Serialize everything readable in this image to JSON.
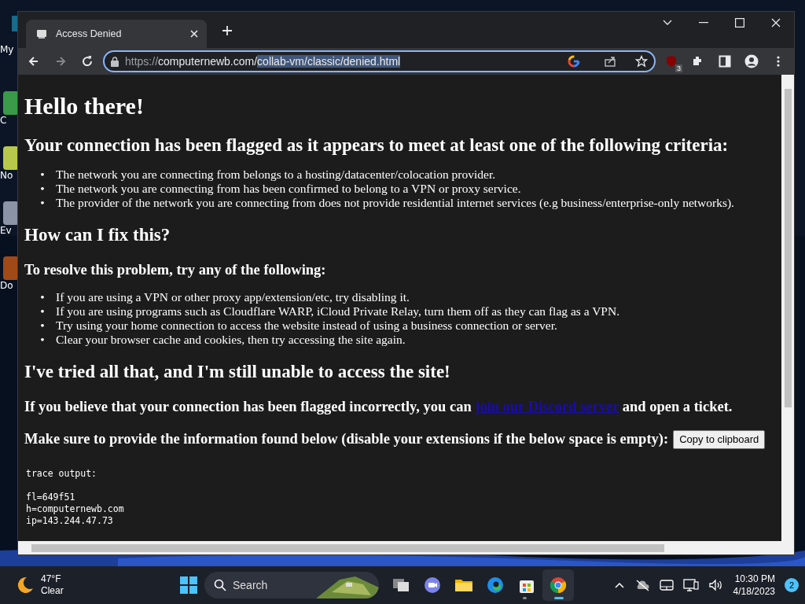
{
  "desktop_icons": [
    {
      "label": "My"
    },
    {
      "label": "C"
    },
    {
      "label": "No"
    },
    {
      "label": "Ev"
    },
    {
      "label": "Do"
    }
  ],
  "browser": {
    "tabs": [
      {
        "title": "Access Denied",
        "selected": true
      }
    ],
    "address": {
      "scheme": "https://",
      "host": "computernewb.com/",
      "selected_path": "collab-vm/classic/denied.html"
    },
    "extension_badge": "3",
    "page": [
      {
        "kind": "h1",
        "text": "Hello there!"
      },
      {
        "kind": "h2",
        "text": "Your connection has been flagged as it appears to meet at least one of the following criteria:"
      },
      {
        "kind": "list",
        "marker": "•",
        "items": [
          "The network you are connecting from belongs to a hosting/datacenter/colocation provider.",
          "The network you are connecting from has been confirmed to belong to a VPN or proxy service.",
          "The provider of the network you are connecting from does not provide residential internet services (e.g business/enterprise-only networks)."
        ]
      },
      {
        "kind": "h2",
        "text": "How can I fix this?"
      },
      {
        "kind": "h3",
        "text": "To resolve this problem, try any of the following:"
      },
      {
        "kind": "list",
        "marker": "•",
        "items": [
          "If you are using a VPN or other proxy app/extension/etc, try disabling it.",
          "If you are using programs such as Cloudflare WARP, iCloud Private Relay, turn them off as they can flag as a VPN.",
          "Try using your home connection to access the website instead of using a business connection or server.",
          "Clear your browser cache and cookies, then try accessing the site again."
        ]
      },
      {
        "kind": "h2",
        "text": "I've tried all that, and I'm still unable to access the site!"
      },
      {
        "kind": "link_para",
        "before": "If you believe that your connection has been flagged incorrectly, you can",
        "link": "join our Discord server",
        "after": "and open a ticket."
      },
      {
        "kind": "button_para",
        "text": "Make sure to provide the information found below (disable your extensions if the below space is empty):",
        "button": "Copy to clipboard"
      },
      {
        "kind": "pre",
        "text": "trace output:\n\nfl=649f51\nh=computernewb.com\nip=143.244.47.73"
      }
    ]
  },
  "taskbar": {
    "weather": {
      "temperature": "47°F",
      "condition": "Clear"
    },
    "search": {
      "placeholder": "Search"
    },
    "apps": [
      {
        "kind": "taskview",
        "active": false
      },
      {
        "kind": "chat",
        "active": false
      },
      {
        "kind": "explorer",
        "active": false
      },
      {
        "kind": "edge",
        "active": false
      },
      {
        "kind": "store",
        "active": false
      },
      {
        "kind": "chrome",
        "active": true
      }
    ],
    "time": "10:30 PM",
    "date": "4/18/2023",
    "notifications": "2"
  }
}
